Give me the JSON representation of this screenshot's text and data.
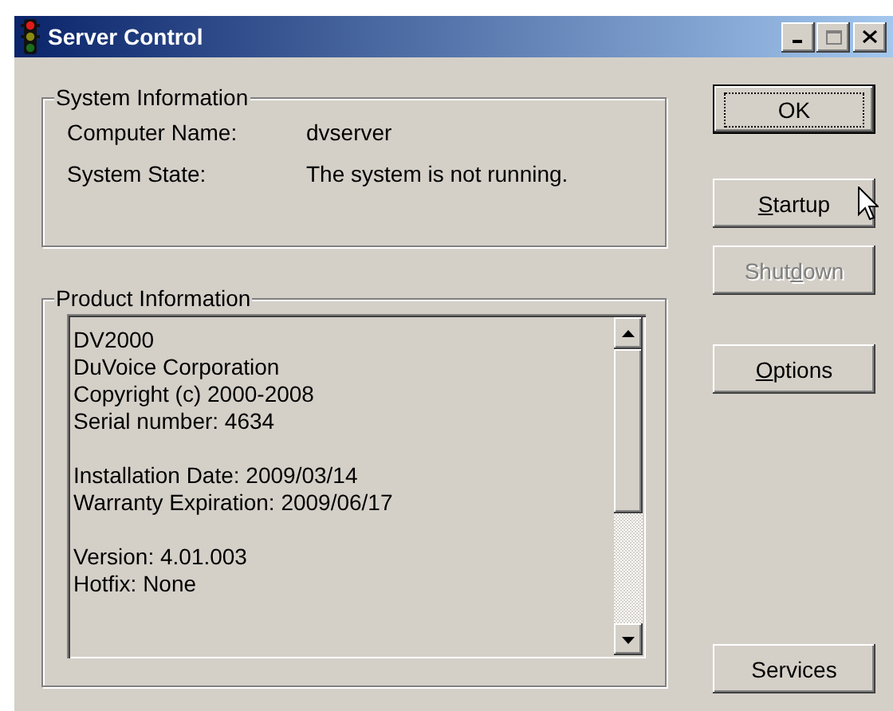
{
  "window": {
    "title": "Server Control"
  },
  "system_information": {
    "title": "System Information",
    "fields": [
      {
        "label": "Computer Name:",
        "value": "dvserver"
      },
      {
        "label": "System State:",
        "value": "The system is not running."
      }
    ]
  },
  "product_information": {
    "title": "Product Information",
    "paragraphs": [
      [
        "DV2000",
        "DuVoice Corporation",
        "Copyright (c) 2000-2008",
        "Serial number: 4634"
      ],
      [
        "Installation Date: 2009/03/14",
        "Warranty Expiration: 2009/06/17"
      ],
      [
        "Version: 4.01.003",
        "Hotfix: None"
      ]
    ]
  },
  "buttons": [
    {
      "label": "OK",
      "default": true,
      "disabled": false,
      "hovered": false
    },
    {
      "label_parts": [
        {
          "text": "S",
          "underlined": true
        },
        {
          "text": "tartup",
          "underlined": false
        }
      ],
      "default": false,
      "disabled": false,
      "hovered": true
    },
    {
      "label_parts": [
        {
          "text": "Shut",
          "underlined": false
        },
        {
          "text": "d",
          "underlined": true
        },
        {
          "text": "own",
          "underlined": false
        }
      ],
      "default": false,
      "disabled": true,
      "hovered": false
    },
    {
      "label_parts": [
        {
          "text": "O",
          "underlined": true
        },
        {
          "text": "ptions",
          "underlined": false
        }
      ],
      "default": false,
      "disabled": false,
      "hovered": false
    },
    {
      "label": "Services",
      "default": false,
      "disabled": false,
      "hovered": false
    }
  ]
}
